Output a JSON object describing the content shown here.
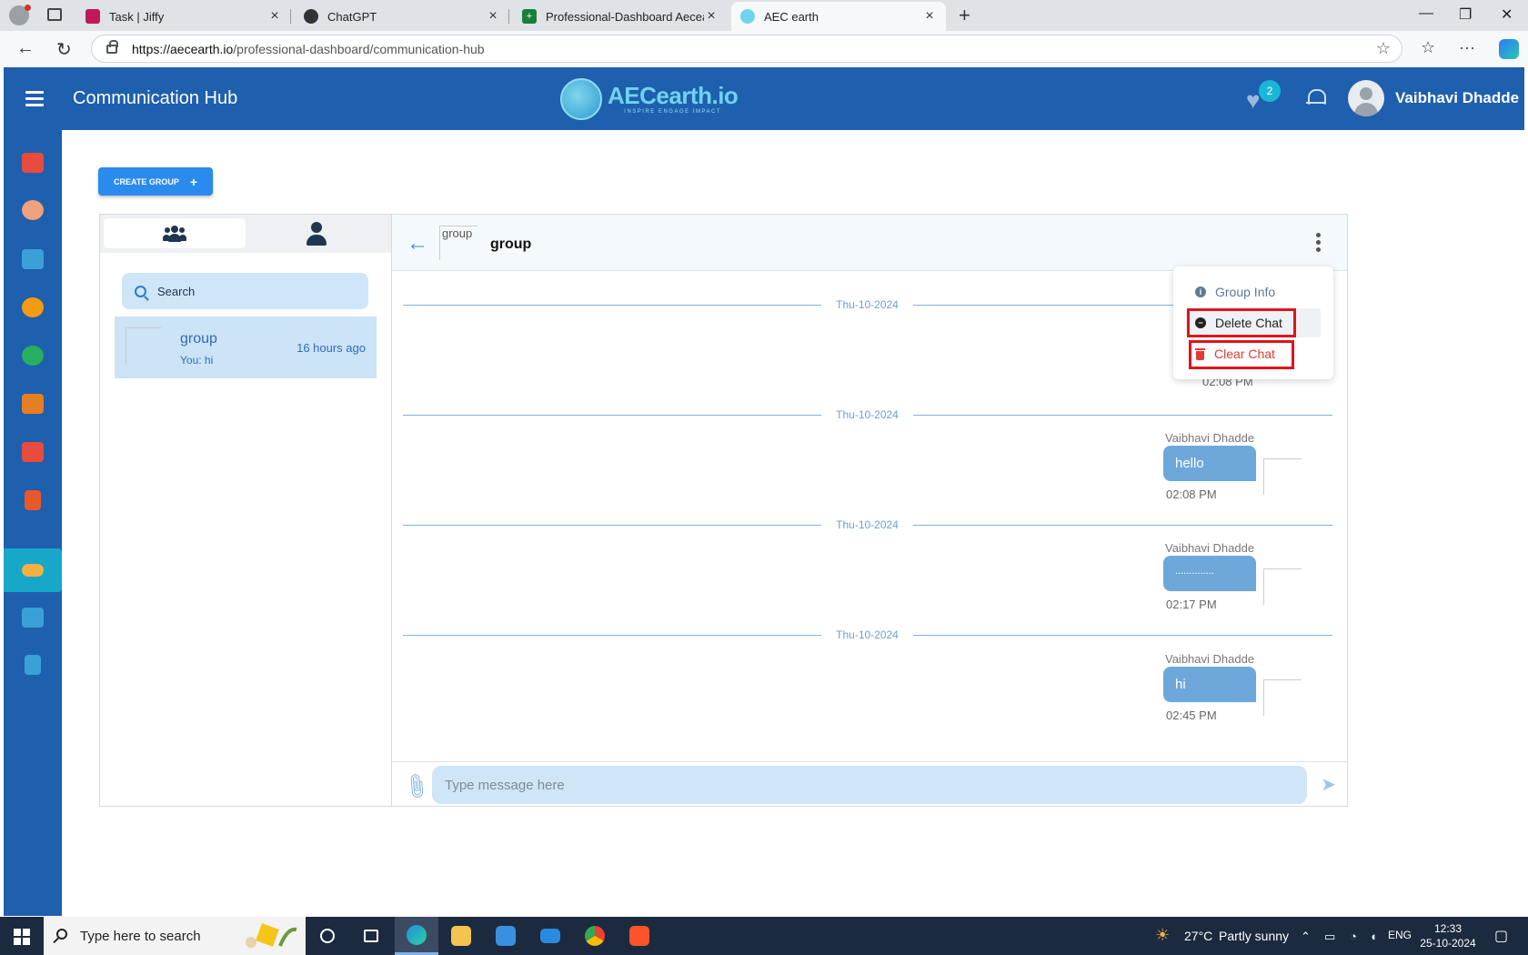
{
  "browser": {
    "tabs": [
      {
        "title": "Task | Jiffy",
        "icon": "fingerprint-icon",
        "color": "#c2185b"
      },
      {
        "title": "ChatGPT",
        "icon": "chatgpt-icon",
        "color": "#333333"
      },
      {
        "title": "Professional-Dashboard Aecearth",
        "icon": "sheets-icon",
        "color": "#188038"
      },
      {
        "title": "AEC earth",
        "icon": "aec-globe-icon",
        "color": "#6fd3f0"
      }
    ],
    "url_host": "https://aecearth.io",
    "url_path": "/professional-dashboard/communication-hub"
  },
  "header": {
    "title": "Communication Hub",
    "logo_name": "AECearth.io",
    "logo_tagline": "INSPIRE ENGAGE IMPACT",
    "favorites_count": "2",
    "user_name": "Vaibhavi Dhadde",
    "accent": "#1e5fae"
  },
  "sidebar": {
    "items": [
      {
        "name": "home",
        "color": "#e74c3c"
      },
      {
        "name": "profile",
        "color": "#f0a07a"
      },
      {
        "name": "store",
        "color": "#3aa0d8"
      },
      {
        "name": "settings",
        "color": "#f39c12"
      },
      {
        "name": "professional",
        "color": "#27ae60"
      },
      {
        "name": "gallery",
        "color": "#e67e22"
      },
      {
        "name": "calendar",
        "color": "#e74c3c"
      },
      {
        "name": "contacts",
        "color": "#e8582b"
      },
      {
        "name": "communication",
        "color": "#f5b041",
        "active": true
      },
      {
        "name": "list",
        "color": "#3aa0d8"
      },
      {
        "name": "documents",
        "color": "#3aa0d8"
      }
    ]
  },
  "main": {
    "create_group_label": "CREATE GROUP",
    "search_placeholder": "Search",
    "chat_list": [
      {
        "name": "group",
        "last": "You: hi",
        "time": "16 hours ago"
      }
    ],
    "chat": {
      "title": "group",
      "thumb_alt": "group",
      "partial_time": "02:08 PM",
      "date_label": "Thu-10-2024",
      "messages": [
        {
          "sender": "Vaibhavi Dhadde",
          "text": "hello",
          "time": "02:08 PM"
        },
        {
          "sender": "Vaibhavi Dhadde",
          "text": "..............",
          "time": "02:17 PM"
        },
        {
          "sender": "Vaibhavi Dhadde",
          "text": "hi",
          "time": "02:45 PM"
        }
      ],
      "composer_placeholder": "Type message here"
    },
    "menu": {
      "group_info": "Group Info",
      "delete_chat": "Delete Chat",
      "clear_chat": "Clear Chat"
    }
  },
  "taskbar": {
    "search_placeholder": "Type here to search",
    "weather_temp": "27°C",
    "weather_text": "Partly sunny",
    "language": "ENG",
    "time": "12:33",
    "date": "25-10-2024"
  }
}
